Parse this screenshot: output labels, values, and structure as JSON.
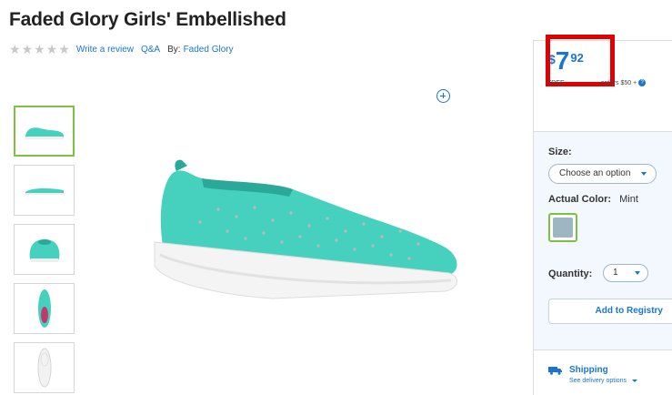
{
  "product": {
    "title": "Faded Glory Girls' Embellished",
    "rating_stars": 5,
    "write_review": "Write a review",
    "qa": "Q&A",
    "by_label": "By:",
    "brand": "Faded Glory"
  },
  "price": {
    "currency": "$",
    "dollars": "7",
    "cents": "92",
    "shipping_note_start": "FREE",
    "shipping_note_end": "orders $50 +",
    "info_icon": "info-icon",
    "highlight_color": "#e00000"
  },
  "options": {
    "size_label": "Size:",
    "size_placeholder": "Choose an option",
    "color_label": "Actual Color:",
    "color_value": "Mint",
    "quantity_label": "Quantity:",
    "quantity_value": "1",
    "registry_button": "Add to Registry"
  },
  "shipping": {
    "title": "Shipping",
    "delivery_link": "See delivery options",
    "icon": "truck-icon"
  },
  "colors": {
    "accent": "#1a75cf",
    "product_mint": "#46d0be",
    "selected_border": "#7bc142"
  },
  "thumbnails": [
    {
      "view": "side"
    },
    {
      "view": "side-flat"
    },
    {
      "view": "back"
    },
    {
      "view": "top"
    },
    {
      "view": "sole"
    }
  ]
}
